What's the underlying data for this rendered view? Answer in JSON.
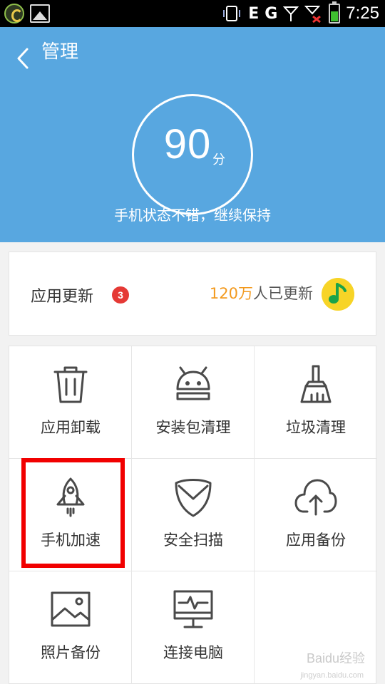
{
  "statusbar": {
    "network_letter": "E",
    "signal_letter": "G",
    "time": "7:25"
  },
  "header": {
    "title": "管理",
    "score": "90",
    "score_unit": "分",
    "status_text": "手机状态不错，继续保持",
    "color": "#58a7e0"
  },
  "update": {
    "label": "应用更新",
    "badge": "3",
    "count_highlight": "120万",
    "count_rest": "人已更新"
  },
  "grid": {
    "items": [
      {
        "label": "应用卸载",
        "icon": "trash-icon"
      },
      {
        "label": "安装包清理",
        "icon": "android-icon"
      },
      {
        "label": "垃圾清理",
        "icon": "broom-icon"
      },
      {
        "label": "手机加速",
        "icon": "rocket-icon"
      },
      {
        "label": "安全扫描",
        "icon": "shield-icon"
      },
      {
        "label": "应用备份",
        "icon": "cloud-upload-icon"
      },
      {
        "label": "照片备份",
        "icon": "image-icon"
      },
      {
        "label": "连接电脑",
        "icon": "monitor-icon"
      }
    ]
  },
  "watermark": {
    "text": "Baidu经验",
    "sub": "jingyan.baidu.com"
  }
}
